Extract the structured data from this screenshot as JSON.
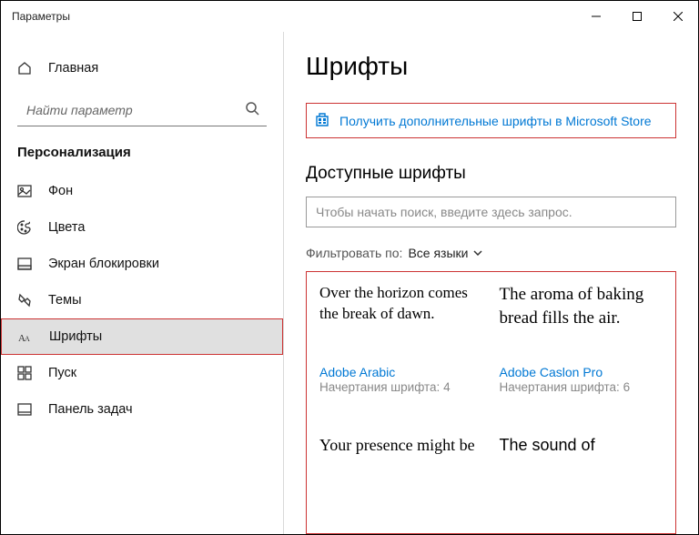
{
  "window": {
    "title": "Параметры"
  },
  "sidebar": {
    "home": "Главная",
    "searchPlaceholder": "Найти параметр",
    "category": "Персонализация",
    "items": [
      {
        "label": "Фон"
      },
      {
        "label": "Цвета"
      },
      {
        "label": "Экран блокировки"
      },
      {
        "label": "Темы"
      },
      {
        "label": "Шрифты"
      },
      {
        "label": "Пуск"
      },
      {
        "label": "Панель задач"
      }
    ]
  },
  "main": {
    "title": "Шрифты",
    "storeLink": "Получить дополнительные шрифты в Microsoft Store",
    "availableTitle": "Доступные шрифты",
    "searchPlaceholder": "Чтобы начать поиск, введите здесь запрос.",
    "filterLabel": "Фильтровать по:",
    "filterValue": "Все языки"
  },
  "fonts": [
    {
      "sample": "Over the horizon comes the break of dawn.",
      "name": "Adobe Arabic",
      "stylesLabel": "Начертания шрифта:",
      "styles": "4"
    },
    {
      "sample": "The aroma of baking bread fills the air.",
      "name": "Adobe Caslon Pro",
      "stylesLabel": "Начертания шрифта:",
      "styles": "6"
    },
    {
      "sample": "Your presence might be",
      "name": "",
      "stylesLabel": "",
      "styles": ""
    },
    {
      "sample": "The sound of",
      "name": "",
      "stylesLabel": "",
      "styles": ""
    }
  ]
}
